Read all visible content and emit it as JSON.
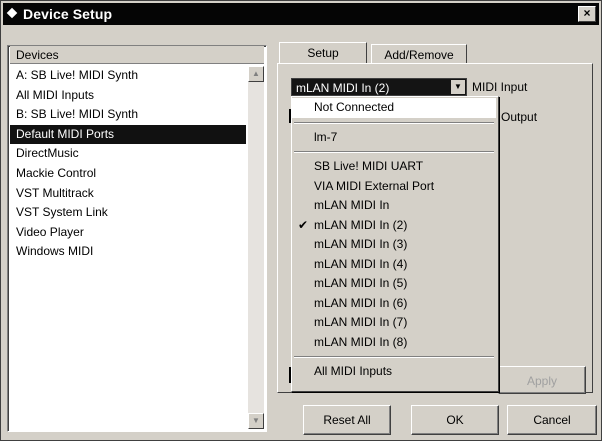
{
  "window": {
    "title": "Device Setup",
    "close_label": "×"
  },
  "devices": {
    "header": "Devices",
    "items": [
      "A: SB Live! MIDI Synth",
      "All MIDI Inputs",
      "B: SB Live! MIDI Synth",
      "Default MIDI Ports",
      "DirectMusic",
      "Mackie Control",
      "VST Multitrack",
      "VST System Link",
      "Video Player",
      "Windows MIDI"
    ],
    "selected": "Default MIDI Ports"
  },
  "tabs": [
    {
      "label": "Setup",
      "active": true
    },
    {
      "label": "Add/Remove",
      "active": false
    }
  ],
  "midi_input": {
    "value": "mLAN MIDI In (2)",
    "label": "MIDI Input"
  },
  "midi_output": {
    "label": "Output"
  },
  "dropdown": {
    "groups": [
      [
        "Not Connected"
      ],
      [
        "lm-7"
      ],
      [
        "SB Live! MIDI UART",
        "VIA MIDI External Port",
        "mLAN MIDI In",
        "mLAN MIDI In (2)",
        "mLAN MIDI In (3)",
        "mLAN MIDI In (4)",
        "mLAN MIDI In (5)",
        "mLAN MIDI In (6)",
        "mLAN MIDI In (7)",
        "mLAN MIDI In (8)"
      ],
      [
        "All MIDI Inputs"
      ]
    ],
    "checked": "mLAN MIDI In (2)",
    "hovered": "Not Connected"
  },
  "buttons": {
    "apply": "Apply",
    "reset_all": "Reset All",
    "ok": "OK",
    "cancel": "Cancel"
  }
}
